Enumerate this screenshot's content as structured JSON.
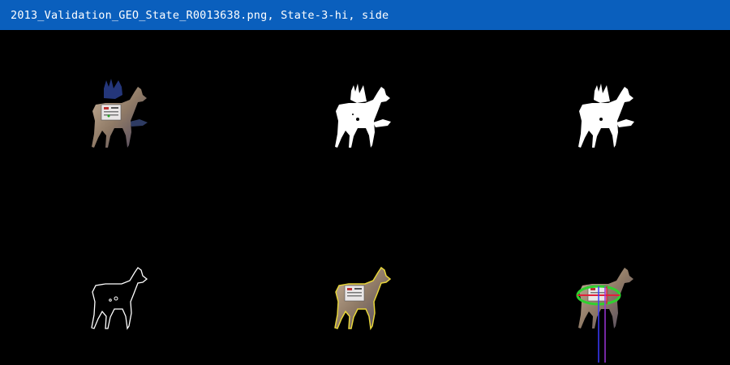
{
  "window": {
    "title": "2013_Validation_GEO_State_R0013638.png, State-3-hi, side"
  },
  "panels": [
    {
      "name": "original-image"
    },
    {
      "name": "binary-mask"
    },
    {
      "name": "filled-mask"
    },
    {
      "name": "contour-outline"
    },
    {
      "name": "contour-overlay"
    },
    {
      "name": "ellipse-measurement-overlay"
    }
  ],
  "colors": {
    "titlebar": "#0a5fbd",
    "background": "#000000",
    "mask": "#ffffff",
    "contour": "#ffffff",
    "overlay_contour": "#e8d63a",
    "ellipse": "#2fd12f",
    "axis_major": "#e0213a",
    "axis_minor": "#3b3bff",
    "axis_vertical": "#9a33d9"
  }
}
